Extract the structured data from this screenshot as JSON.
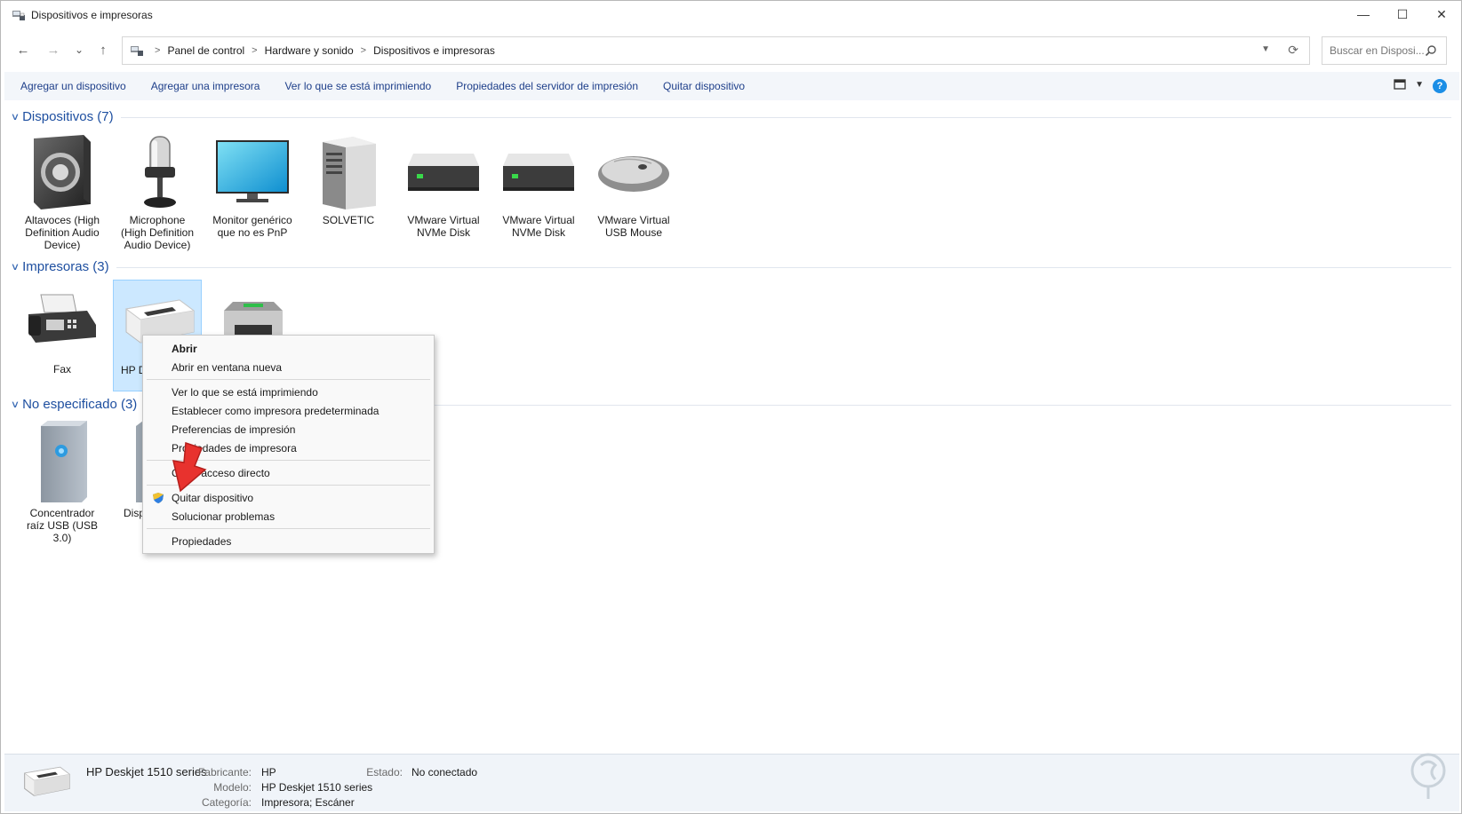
{
  "window": {
    "title": "Dispositivos e impresoras",
    "controls": {
      "minimize": "—",
      "maximize": "☐",
      "close": "✕"
    }
  },
  "nav": {
    "back": "←",
    "forward": "→",
    "recent": "⌄",
    "up": "↑",
    "breadcrumb": [
      "Panel de control",
      "Hardware y sonido",
      "Dispositivos e impresoras"
    ],
    "search_placeholder": "Buscar en Disposi..."
  },
  "commands": [
    "Agregar un dispositivo",
    "Agregar una impresora",
    "Ver lo que se está imprimiendo",
    "Propiedades del servidor de impresión",
    "Quitar dispositivo"
  ],
  "help_label": "?",
  "groups": {
    "devices": {
      "title": "Dispositivos (7)",
      "items": [
        {
          "line1": "Altavoces (High",
          "line2": "Definition Audio",
          "line3": "Device)",
          "icon": "speaker-icon"
        },
        {
          "line1": "Microphone",
          "line2": "(High Definition",
          "line3": "Audio Device)",
          "icon": "microphone-icon"
        },
        {
          "line1": "Monitor genérico",
          "line2": "que no es PnP",
          "line3": "",
          "icon": "monitor-icon"
        },
        {
          "line1": "SOLVETIC",
          "line2": "",
          "line3": "",
          "icon": "computer-tower-icon"
        },
        {
          "line1": "VMware Virtual",
          "line2": "NVMe Disk",
          "line3": "",
          "icon": "disk-drive-icon"
        },
        {
          "line1": "VMware Virtual",
          "line2": "NVMe Disk",
          "line3": "",
          "icon": "disk-drive-icon"
        },
        {
          "line1": "VMware Virtual",
          "line2": "USB Mouse",
          "line3": "",
          "icon": "mouse-icon"
        }
      ]
    },
    "printers": {
      "title": "Impresoras (3)",
      "items": [
        {
          "line1": "Fax",
          "icon": "fax-icon"
        },
        {
          "line1": "HP D",
          "icon": "inkjet-printer-icon"
        },
        {
          "line1": "",
          "icon": "laser-printer-icon"
        }
      ]
    },
    "unspecified": {
      "title": "No especificado (3)",
      "items": [
        {
          "line1": "Concentrador",
          "line2": "raíz USB (USB 3.0)",
          "icon": "usb-hub-icon"
        },
        {
          "line1": "Disp",
          "line2": "",
          "icon": "usb-hub-icon"
        }
      ]
    }
  },
  "context_menu": {
    "open": "Abrir",
    "open_new_window": "Abrir en ventana nueva",
    "see_printing": "Ver lo que se está imprimiendo",
    "set_default": "Establecer como impresora predeterminada",
    "print_prefs": "Preferencias de impresión",
    "printer_props": "Propiedades de impresora",
    "create_shortcut": "Crear acceso directo",
    "remove_device": "Quitar dispositivo",
    "troubleshoot": "Solucionar problemas",
    "properties": "Propiedades"
  },
  "details": {
    "name": "HP Deskjet 1510 series",
    "manufacturer_label": "Fabricante:",
    "manufacturer": "HP",
    "model_label": "Modelo:",
    "model": "HP Deskjet 1510 series",
    "category_label": "Categoría:",
    "category": "Impresora; Escáner",
    "status_label": "Estado:",
    "status": "No conectado"
  },
  "colors": {
    "link": "#1e3f8a",
    "group_title": "#1e4fa0",
    "selection": "#cce8ff",
    "arrow": "#e8322e"
  }
}
